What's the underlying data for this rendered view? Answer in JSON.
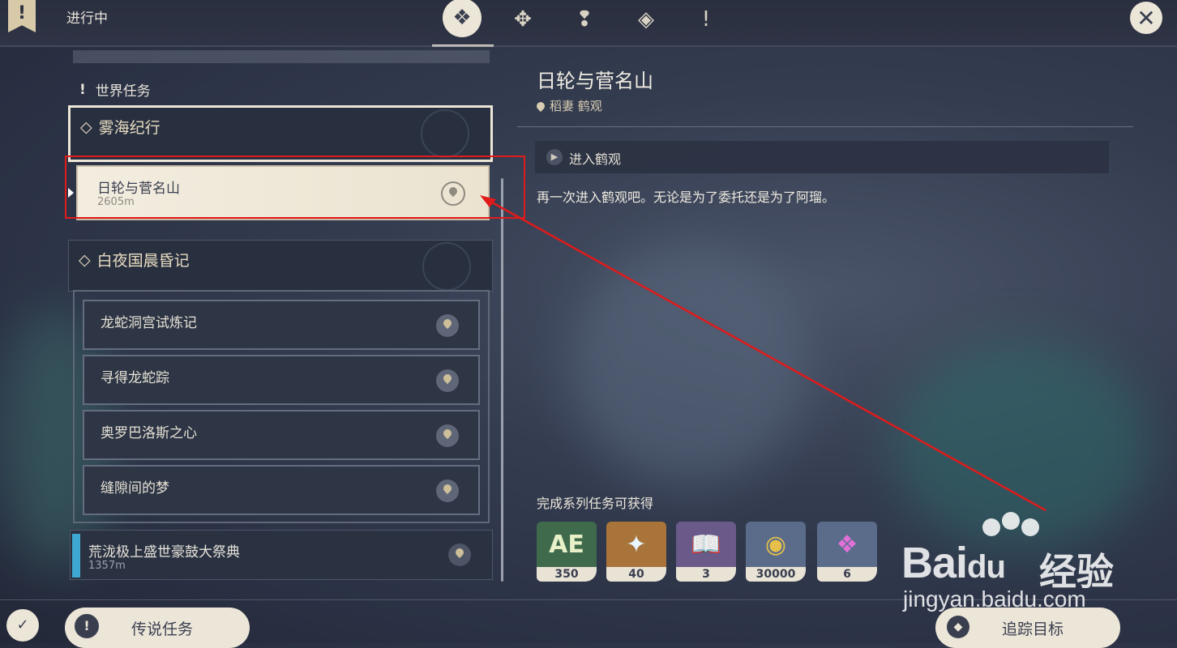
{
  "header": {
    "status_label": "进行中",
    "bookmark_glyph": "!",
    "category_tabs": [
      {
        "icon": "archon-quest-icon",
        "glyph": "❖",
        "active": true
      },
      {
        "icon": "story-quest-icon",
        "glyph": "✥",
        "active": false
      },
      {
        "icon": "world-quest-icon",
        "glyph": "❢",
        "active": false
      },
      {
        "icon": "commission-icon",
        "glyph": "◈",
        "active": false
      },
      {
        "icon": "event-quest-icon",
        "glyph": "!",
        "active": false
      }
    ],
    "close_glyph": "✕"
  },
  "quest_list": {
    "section_title": "世界任务",
    "section_icon_glyph": "!",
    "chapters": [
      {
        "title": "雾海纪行",
        "quests": [
          {
            "name": "日轮与菅名山",
            "distance": "2605m",
            "selected": true
          }
        ]
      },
      {
        "title": "白夜国晨昏记",
        "quests": [
          {
            "name": "龙蛇洞宫试炼记"
          },
          {
            "name": "寻得龙蛇踪"
          },
          {
            "name": "奥罗巴洛斯之心"
          },
          {
            "name": "缝隙间的梦"
          }
        ]
      }
    ],
    "festival_quest": {
      "name": "荒泷极上盛世豪鼓大祭典",
      "distance": "1357m"
    }
  },
  "detail": {
    "title": "日轮与菅名山",
    "location": "稻妻 鹤观",
    "step_text": "进入鹤观",
    "description": "再一次进入鹤观吧。无论是为了委托还是为了阿瑠。",
    "rewards_label": "完成系列任务可获得",
    "rewards": [
      {
        "icon": "adventure-exp-icon",
        "glyph": "AE",
        "count": "350",
        "bg": "#3f6a4c"
      },
      {
        "icon": "primogem-icon",
        "glyph": "✦",
        "count": "40",
        "bg": "#a9743a"
      },
      {
        "icon": "heros-wit-book-icon",
        "glyph": "📖",
        "count": "3",
        "bg": "#6a5a8a"
      },
      {
        "icon": "mora-icon",
        "glyph": "◉",
        "count": "30000",
        "bg": "#5a6c8a"
      },
      {
        "icon": "crystal-icon",
        "glyph": "❖",
        "count": "6",
        "bg": "#5a6c8a"
      }
    ]
  },
  "footer": {
    "legend_button": "传说任务",
    "track_button": "追踪目标",
    "left_icon_glyph": "✓",
    "legend_icon_glyph": "!",
    "track_icon_glyph": "◆"
  },
  "watermark": {
    "logo": "Bai",
    "logo2": "du",
    "cn": "经验",
    "url": "jingyan.baidu.com"
  },
  "colors": {
    "annotation_red": "#e11a1a",
    "accent_cream": "#ece6d8",
    "festival_blue": "#3ea7d2"
  }
}
